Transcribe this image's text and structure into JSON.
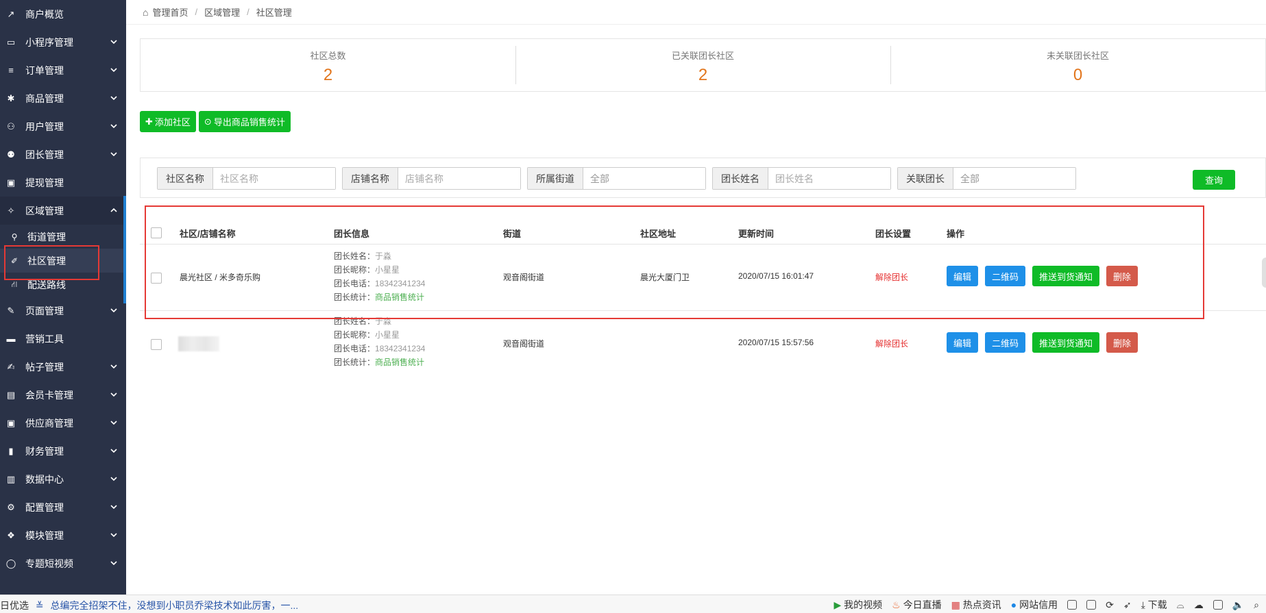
{
  "sidebar": {
    "items": [
      {
        "label": "商户概览",
        "icon": "chart-line-icon",
        "has_chevron": false
      },
      {
        "label": "小程序管理",
        "icon": "monitor-icon",
        "has_chevron": true
      },
      {
        "label": "订单管理",
        "icon": "list-icon",
        "has_chevron": true
      },
      {
        "label": "商品管理",
        "icon": "gift-icon",
        "has_chevron": true
      },
      {
        "label": "用户管理",
        "icon": "user-icon",
        "has_chevron": true
      },
      {
        "label": "团长管理",
        "icon": "users-icon",
        "has_chevron": true
      },
      {
        "label": "提现管理",
        "icon": "money-icon",
        "has_chevron": false
      },
      {
        "label": "区域管理",
        "icon": "crosshair-icon",
        "has_chevron": true
      }
    ],
    "sub_items": [
      {
        "label": "街道管理",
        "icon": "map-marker-icon"
      },
      {
        "label": "社区管理",
        "icon": "pushpin-icon"
      },
      {
        "label": "配送路线",
        "icon": "road-icon"
      }
    ],
    "items_after": [
      {
        "label": "页面管理",
        "icon": "brush-icon",
        "has_chevron": true
      },
      {
        "label": "营销工具",
        "icon": "briefcase-icon",
        "has_chevron": false
      },
      {
        "label": "帖子管理",
        "icon": "edit-icon",
        "has_chevron": true
      },
      {
        "label": "会员卡管理",
        "icon": "id-card-icon",
        "has_chevron": true
      },
      {
        "label": "供应商管理",
        "icon": "suitcase-icon",
        "has_chevron": true
      },
      {
        "label": "财务管理",
        "icon": "signal-icon",
        "has_chevron": true
      },
      {
        "label": "数据中心",
        "icon": "bar-chart-icon",
        "has_chevron": true
      },
      {
        "label": "配置管理",
        "icon": "cogs-icon",
        "has_chevron": true
      },
      {
        "label": "模块管理",
        "icon": "cubes-icon",
        "has_chevron": true
      },
      {
        "label": "专题短视频",
        "icon": "comment-icon",
        "has_chevron": true
      }
    ]
  },
  "breadcrumb": {
    "home": "管理首页",
    "level2": "区域管理",
    "level3": "社区管理"
  },
  "stats": [
    {
      "label": "社区总数",
      "value": "2"
    },
    {
      "label": "已关联团长社区",
      "value": "2"
    },
    {
      "label": "未关联团长社区",
      "value": "0"
    }
  ],
  "toolbar": {
    "add_label": "添加社区",
    "export_label": "导出商品销售统计"
  },
  "filters": {
    "community_label": "社区名称",
    "community_placeholder": "社区名称",
    "shop_label": "店铺名称",
    "shop_placeholder": "店铺名称",
    "street_label": "所属街道",
    "street_value": "全部",
    "leader_label": "团长姓名",
    "leader_placeholder": "团长姓名",
    "linked_label": "关联团长",
    "linked_value": "全部",
    "query_label": "查询"
  },
  "table": {
    "headers": [
      "社区/店铺名称",
      "团长信息",
      "街道",
      "社区地址",
      "更新时间",
      "团长设置",
      "操作"
    ],
    "leader_fields": {
      "name": "团长姓名：",
      "nick": "团长昵称：",
      "phone": "团长电话：",
      "stats": "团长统计："
    },
    "rows": [
      {
        "name": "晨光社区  / 米多奇乐购",
        "leader_name": "于淼",
        "leader_nick": "小星星",
        "leader_phone": "18342341234",
        "leader_stats": "商品销售统计",
        "street": "观音阁街道",
        "address": "晨光大厦门卫",
        "updated": "2020/07/15 16:01:47",
        "setting": "解除团长"
      },
      {
        "name": "",
        "leader_name": "于淼",
        "leader_nick": "小星星",
        "leader_phone": "18342341234",
        "leader_stats": "商品销售统计",
        "street": "观音阁街道",
        "address": "",
        "updated": "2020/07/15 15:57:56",
        "setting": "解除团长"
      }
    ],
    "ops": {
      "edit": "编辑",
      "qrcode": "二维码",
      "push": "推送到货通知",
      "delete": "删除"
    }
  },
  "statusbar": {
    "left": "日优选",
    "news": "总编完全招架不住，没想到小职员乔梁技术如此厉害，一...",
    "right": [
      "我的视频",
      "今日直播",
      "热点资讯",
      "网站信用",
      "下载"
    ]
  }
}
